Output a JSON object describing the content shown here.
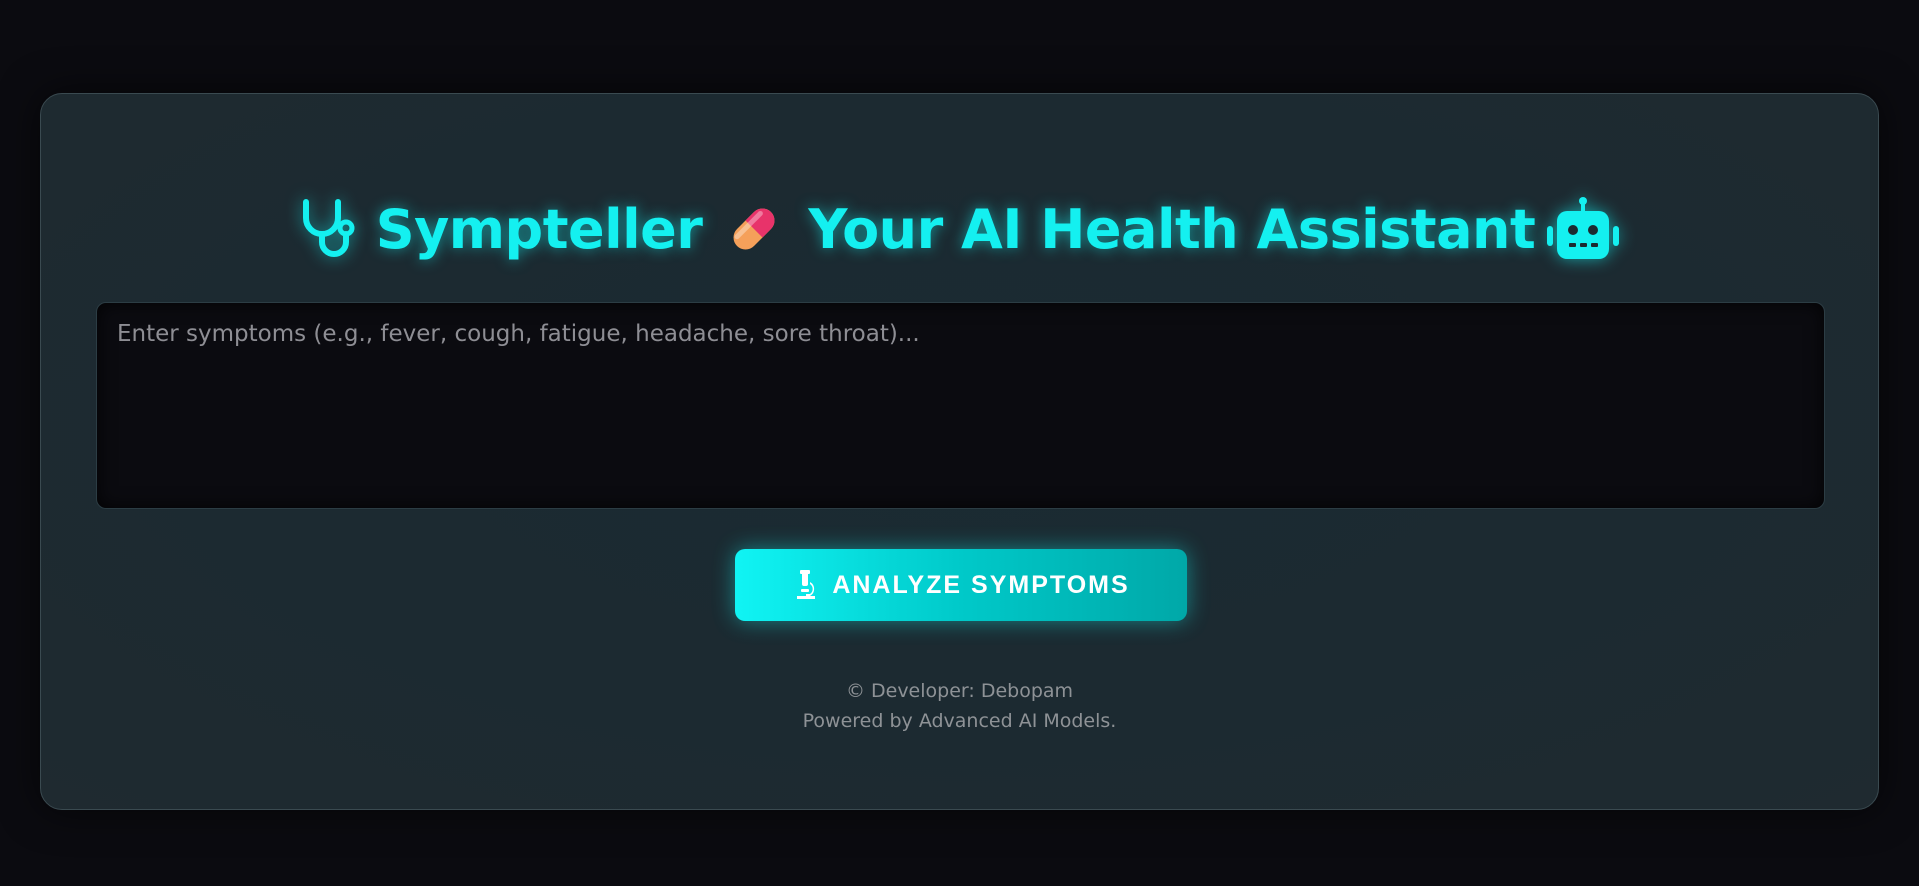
{
  "header": {
    "app_name": "Sympteller",
    "tagline": "Your AI Health Assistant",
    "icons": {
      "left": "stethoscope-icon",
      "middle": "pill-icon",
      "right": "robot-icon"
    }
  },
  "symptom_input": {
    "value": "",
    "placeholder": "Enter symptoms (e.g., fever, cough, fatigue, headache, sore throat)..."
  },
  "analyze_button": {
    "icon": "microscope-icon",
    "label": "ANALYZE SYMPTOMS"
  },
  "footer": {
    "developer": "© Developer: Debopam",
    "powered_by": "Powered by Advanced AI Models."
  },
  "colors": {
    "accent": "#14f0f0",
    "background": "#0b0b10",
    "card": "#1c2a31",
    "muted_text": "#8e9296"
  }
}
